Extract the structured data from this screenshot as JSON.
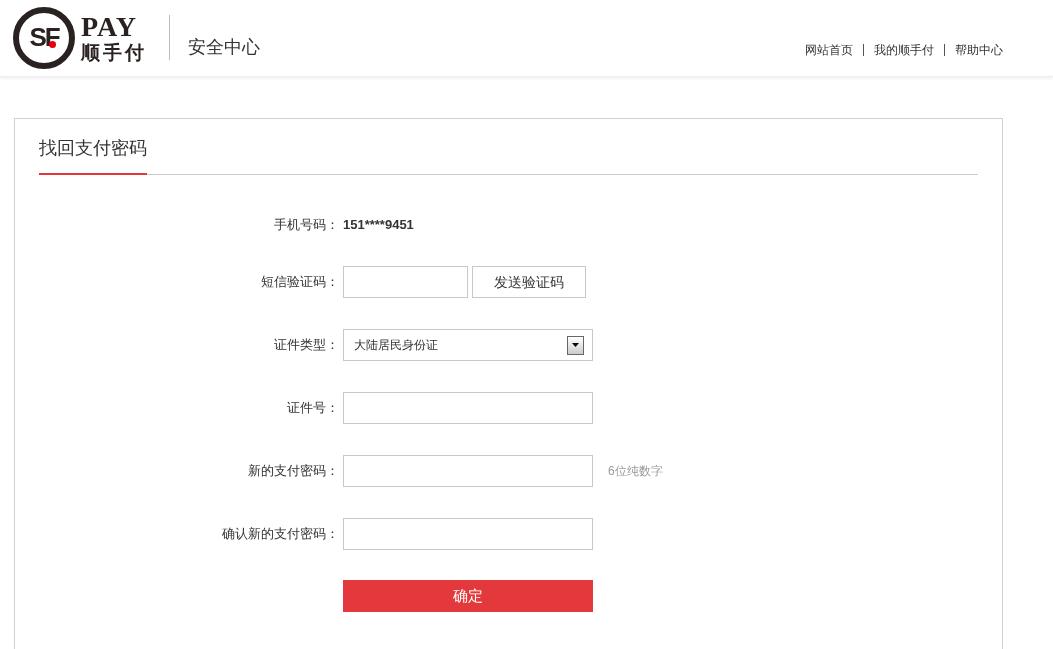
{
  "header": {
    "logo": {
      "mark": "SF",
      "brand": "PAY",
      "name": "顺手付"
    },
    "section": "安全中心",
    "nav": [
      "网站首页",
      "我的顺手付",
      "帮助中心"
    ]
  },
  "card": {
    "title": "找回支付密码",
    "rows": [
      {
        "kind": "text",
        "label": "手机号码：",
        "value": "151****9451"
      },
      {
        "kind": "input_button",
        "label": "短信验证码：",
        "button": "发送验证码"
      },
      {
        "kind": "select",
        "label": "证件类型：",
        "value": "大陆居民身份证"
      },
      {
        "kind": "input",
        "label": "证件号："
      },
      {
        "kind": "input",
        "label": "新的支付密码：",
        "hint": "6位纯数字"
      },
      {
        "kind": "input",
        "label": "确认新的支付密码："
      }
    ],
    "submit": "确定"
  }
}
